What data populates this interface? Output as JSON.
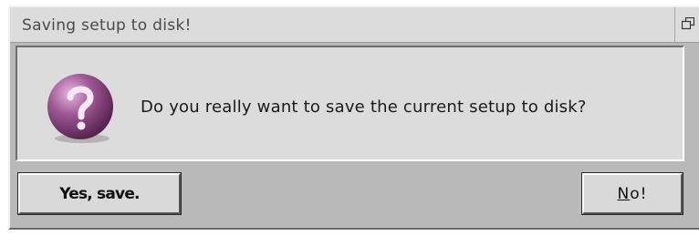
{
  "window": {
    "title": "Saving setup to disk!",
    "restore_icon": "restore-window-icon"
  },
  "dialog": {
    "icon": "question-icon",
    "message": "Do you really want to save the current setup to disk?"
  },
  "buttons": {
    "yes_label": "Yes, save.",
    "no_mnemonic": "N",
    "no_rest": "o!"
  },
  "colors": {
    "icon_fill": "#8e4f86",
    "panel_bg": "#dcdcdc",
    "window_bg": "#b9b9b9"
  }
}
